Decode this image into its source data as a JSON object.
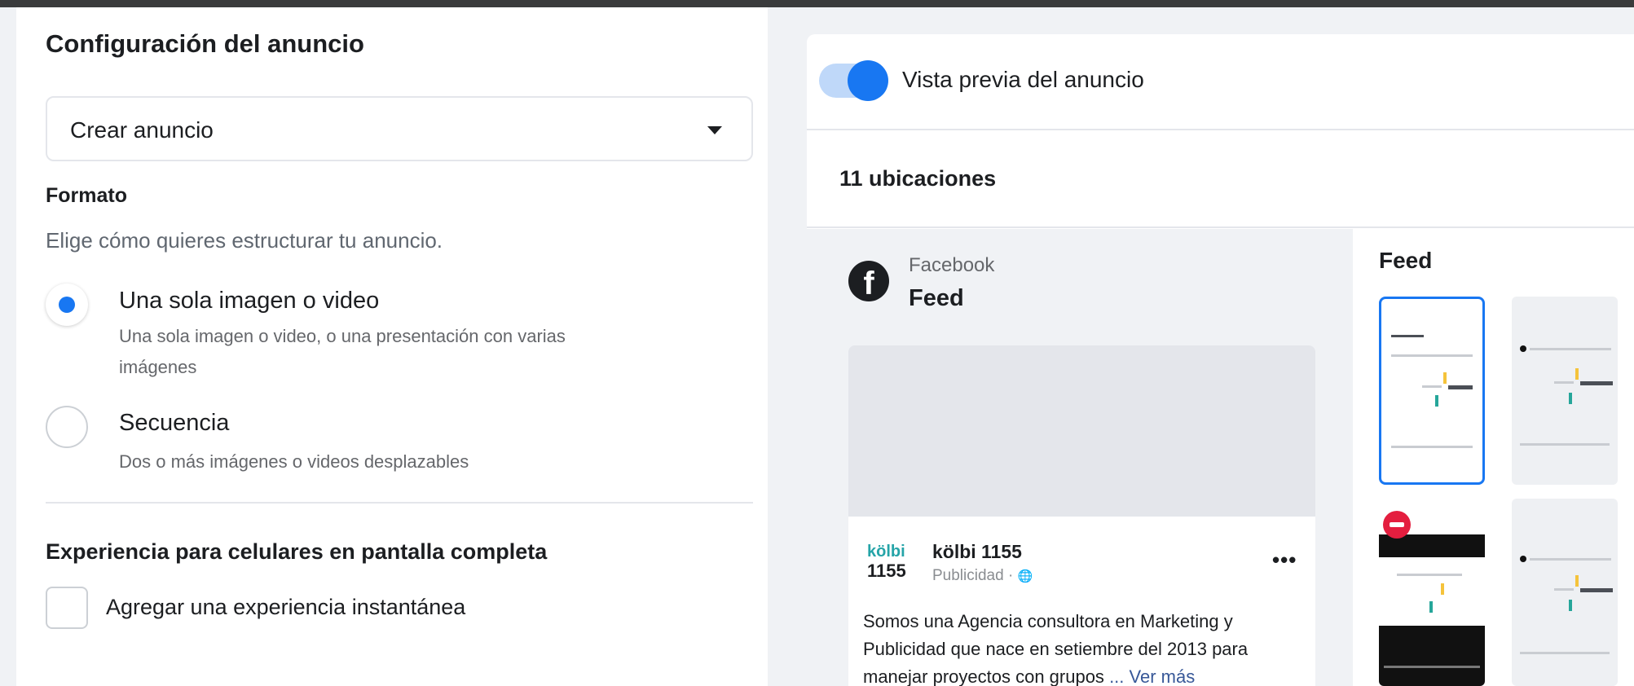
{
  "left_panel": {
    "section_title": "Configuración del anuncio",
    "dropdown": {
      "value": "Crear anuncio"
    },
    "format": {
      "title": "Formato",
      "help": "Elige cómo quieres estructurar tu anuncio.",
      "options": [
        {
          "label": "Una sola imagen o video",
          "description_line1": "Una sola imagen o video, o una presentación con varias",
          "description_line2": "imágenes",
          "selected": true
        },
        {
          "label": "Secuencia",
          "description_line1": "Dos o más imágenes o videos desplazables",
          "selected": false
        }
      ]
    },
    "mobile_experience": {
      "title": "Experiencia para celulares en pantalla completa",
      "checkbox_label": "Agregar una experiencia instantánea",
      "checked": false
    }
  },
  "right_panel": {
    "preview_toggle_label": "Vista previa del anuncio",
    "preview_toggle_on": true,
    "placements_count_label": "11 ubicaciones",
    "platform": {
      "name": "Facebook",
      "placement": "Feed"
    },
    "ad": {
      "brand_logo_top": "kölbi",
      "brand_logo_bottom": "1155",
      "page_name": "kölbi 1155",
      "sponsored": "Publicidad · ",
      "more_options": "•••",
      "text": "Somos una Agencia consultora en Marketing y Publicidad que nace en setiembre del 2013 para manejar proyectos con grupos ",
      "see_more": "... Ver más"
    },
    "thumbnails_title": "Feed"
  },
  "colors": {
    "accent": "#1877f2",
    "toggle_track": "#bfd8f9",
    "panel_bg": "#f0f2f5",
    "brand_teal": "#25a4a8"
  }
}
